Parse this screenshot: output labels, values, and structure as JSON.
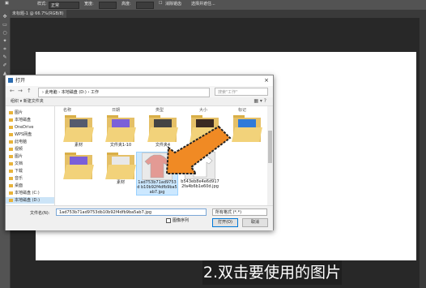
{
  "options_bar": {
    "style_label": "样式:",
    "style_value": "正常",
    "width_label": "宽度:",
    "height_label": "高度:",
    "antialias_label": "消除锯齿",
    "select_mask_label": "选择并遮住..."
  },
  "doc_tab": {
    "label": "未标题-1 @ 66.7%(RGB/8)"
  },
  "dialog": {
    "title": "打开",
    "close_glyph": "×",
    "nav_back": "←",
    "nav_forward": "→",
    "nav_up": "↑",
    "breadcrumb": "› 此电脑 › 本地磁盘 (D:) › 工作",
    "search_placeholder": "搜索\"工作\"",
    "organize_label": "组织 ▾   新建文件夹",
    "view_glyphs": "▦ ▾  ?",
    "sidebar": [
      {
        "label": "图片",
        "icon": "folder-icon"
      },
      {
        "label": "本地磁盘",
        "icon": "folder-icon"
      },
      {
        "label": "OneDrive",
        "icon": "cloud-icon"
      },
      {
        "label": "WPS网盘",
        "icon": "cloud-icon"
      },
      {
        "label": "此电脑",
        "icon": "pc-icon"
      },
      {
        "label": "视频",
        "icon": "folder-icon"
      },
      {
        "label": "图片",
        "icon": "folder-icon"
      },
      {
        "label": "文档",
        "icon": "folder-icon"
      },
      {
        "label": "下载",
        "icon": "folder-icon"
      },
      {
        "label": "音乐",
        "icon": "folder-icon"
      },
      {
        "label": "桌面",
        "icon": "folder-icon"
      },
      {
        "label": "本地磁盘 (C:)",
        "icon": "drive-icon"
      },
      {
        "label": "本地磁盘 (D:)",
        "icon": "drive-icon"
      }
    ],
    "headers": [
      "名称",
      "日期",
      "类型",
      "大小",
      "标记"
    ],
    "files": [
      {
        "name": "素材",
        "kind": "folder",
        "doc_color": "#555b6e"
      },
      {
        "name": "文件夹1-10",
        "kind": "folder",
        "doc_color": "#7b5fd9"
      },
      {
        "name": "文件夹4",
        "kind": "folder",
        "doc_color": "#444"
      },
      {
        "name": "",
        "kind": "folder",
        "doc_color": "#3b2a22"
      },
      {
        "name": "",
        "kind": "folder",
        "doc_color": "#2f7ad9"
      },
      {
        "name": "",
        "kind": "folder",
        "doc_color": "#7b5fd9"
      },
      {
        "name": "素材",
        "kind": "folder",
        "doc_color": "#e8e8e8"
      },
      {
        "name": "1ad753b71ad9753d b10b92f4dfb9ba5ab7.jpg",
        "kind": "pink-shirt"
      },
      {
        "name": "b543eb8e4e6d917 2fa4b6b1e60d.jpg",
        "kind": "white-shirt"
      }
    ],
    "filename_label": "文件名(N):",
    "filename_value": "1ad753b71ad9753db10b92f4dfb9ba5ab7.jpg",
    "filetype_value": "所有格式 (*.*)",
    "sequence_label": "图像序列",
    "open_label": "打开(O)",
    "cancel_label": "取消"
  },
  "caption": "2.双击要使用的图片",
  "colors": {
    "accent": "#f08a24",
    "selection": "#cce8ff"
  }
}
